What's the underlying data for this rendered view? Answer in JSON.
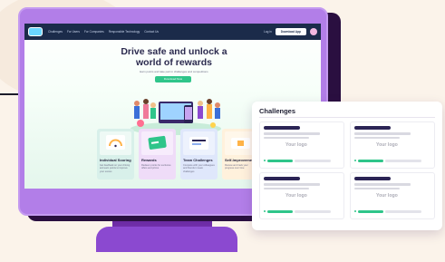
{
  "nav": {
    "links": [
      "Challenges",
      "For Users",
      "For Companies",
      "Responsible Technology",
      "Contact Us"
    ],
    "signin": "Log in",
    "cta": "Download App"
  },
  "hero": {
    "title": "Drive safe and unlock a world of rewards",
    "subtitle": "Earn points and take part in challenges and competitions",
    "button": "Download Now"
  },
  "cards": [
    {
      "title": "Individual Scoring",
      "desc": "Get feedback on your driving and earn points to improve your scores",
      "color": "#d8f0ea"
    },
    {
      "title": "Rewards",
      "desc": "Redeem points for exclusive offers and prizes",
      "color": "#efdcf8"
    },
    {
      "title": "Team Challenges",
      "desc": "Compete with your colleagues and friends in team challenges",
      "color": "#dfe7fb"
    },
    {
      "title": "Self-Improvement",
      "desc": "Review and track your progress over time",
      "color": "#fff1dc"
    }
  ],
  "popup": {
    "title": "Challenges",
    "logo_text": "Your logo",
    "items": [
      {
        "progress": 0.4
      },
      {
        "progress": 0.45
      },
      {
        "progress": 0.35
      },
      {
        "progress": 0.4
      }
    ]
  }
}
